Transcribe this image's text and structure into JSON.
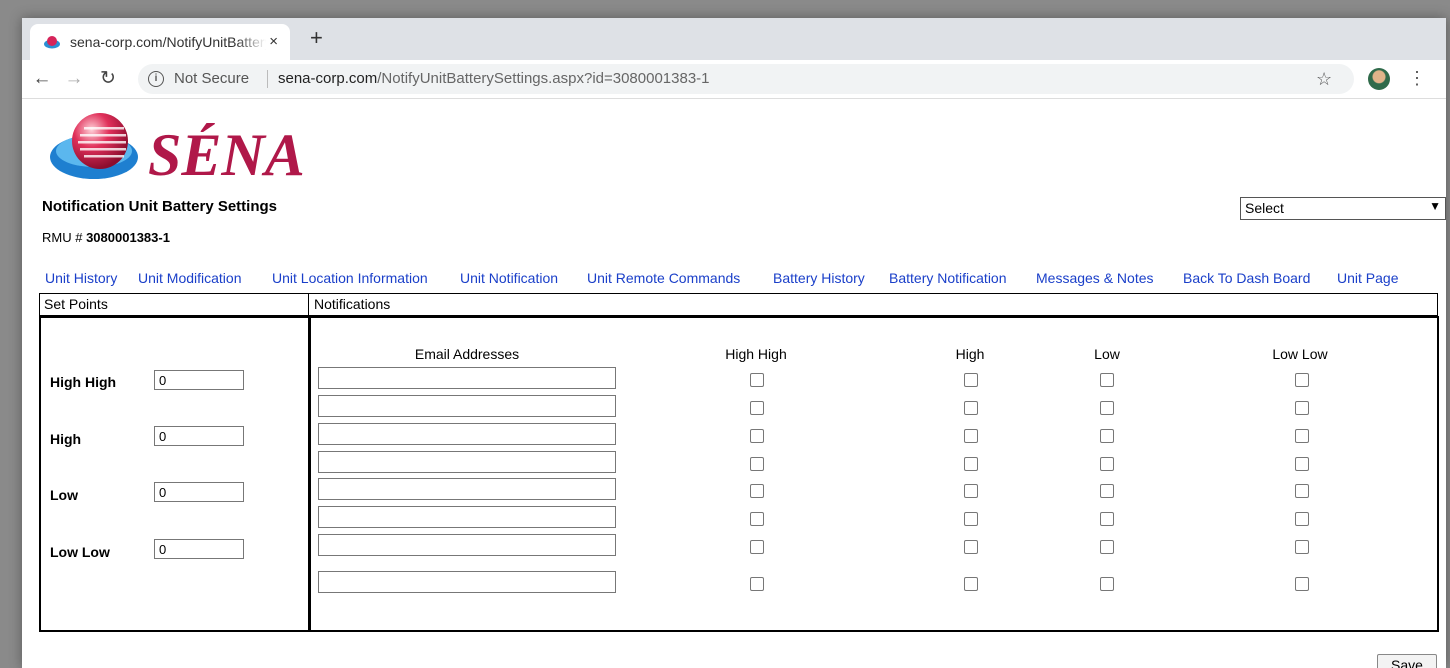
{
  "browser": {
    "tab_title": "sena-corp.com/NotifyUnitBatterySettings.aspx?id=3080001383-1",
    "tab_close": "×",
    "new_tab": "+",
    "security_label": "Not Secure",
    "url_host": "sena-corp.com",
    "url_path": "/NotifyUnitBatterySettings.aspx?id=3080001383-1"
  },
  "logo_text": "SÉNA",
  "page": {
    "title": "Notification Unit Battery Settings",
    "rmu_label": "RMU #",
    "rmu_value": "3080001383-1",
    "select_value": "Select"
  },
  "nav_links": [
    "Unit History",
    "Unit Modification",
    "Unit Location Information",
    "Unit Notification",
    "Unit Remote Commands",
    "Battery History",
    "Battery Notification",
    "Messages & Notes",
    "Back To Dash Board",
    "Unit Page"
  ],
  "set_points": {
    "header": "Set Points",
    "items": [
      {
        "label": "High High",
        "value": "0"
      },
      {
        "label": "High",
        "value": "0"
      },
      {
        "label": "Low",
        "value": "0"
      },
      {
        "label": "Low Low",
        "value": "0"
      }
    ]
  },
  "notifications": {
    "header": "Notifications",
    "columns": [
      "Email Addresses",
      "High High",
      "High",
      "Low",
      "Low Low"
    ],
    "row_count": 8
  },
  "save_label": "Save"
}
